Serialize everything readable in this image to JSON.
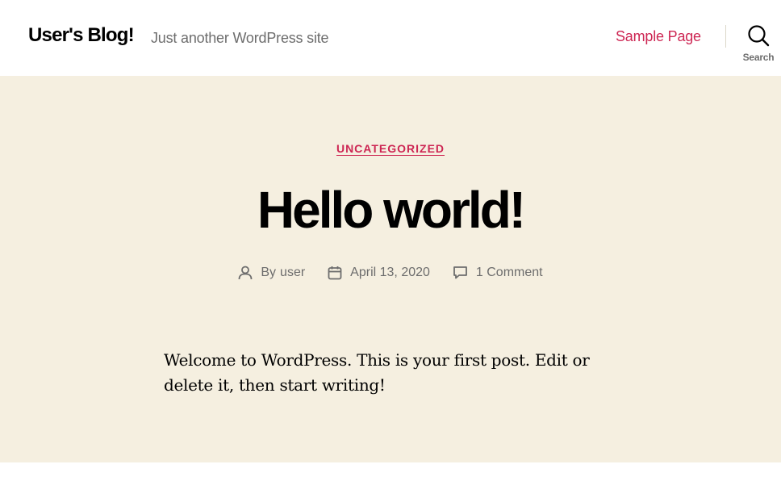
{
  "header": {
    "site_title": "User's Blog!",
    "site_description": "Just another WordPress site",
    "nav_link": "Sample Page",
    "search_label": "Search"
  },
  "post": {
    "category": "UNCATEGORIZED",
    "title": "Hello world!",
    "by_label": "By",
    "author": "user",
    "date": "April 13, 2020",
    "comments": "1 Comment",
    "excerpt": "Welcome to WordPress. This is your first post. Edit or delete it, then start writing!"
  },
  "colors": {
    "accent": "#cd2653",
    "background": "#f5efe0",
    "header_bg": "#ffffff",
    "secondary_text": "#6d6d6d"
  },
  "icons": {
    "search": "search-icon",
    "author": "person-icon",
    "date": "calendar-icon",
    "comments": "comment-icon"
  }
}
